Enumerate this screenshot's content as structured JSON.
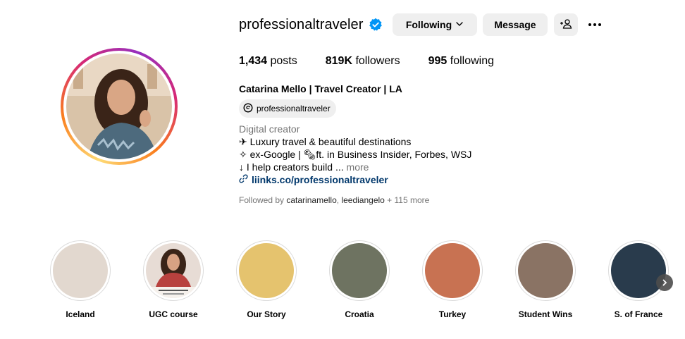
{
  "profile": {
    "username": "professionaltraveler",
    "verified_icon": "verified-badge-icon",
    "full_name": "Catarina Mello | Travel Creator | LA",
    "threads_handle": "professionaltraveler"
  },
  "actions": {
    "following_label": "Following",
    "message_label": "Message"
  },
  "stats": {
    "posts_count": "1,434",
    "posts_label": "posts",
    "followers_count": "819K",
    "followers_label": "followers",
    "following_count": "995",
    "following_label": "following"
  },
  "bio": {
    "category": "Digital creator",
    "line1": "✈ Luxury travel & beautiful destinations",
    "line2": "✧ ex-Google | 🗞ft. in Business Insider, Forbes, WSJ",
    "line3": "↓ I help creators build ...",
    "more_label": "more",
    "link": "liinks.co/professionaltraveler"
  },
  "followed_by": {
    "prefix": "Followed by",
    "user1": "catarinamello",
    "separator": ",",
    "user2": "leediangelo",
    "suffix": "+ 115 more"
  },
  "highlights": [
    {
      "label": "Iceland",
      "color": "#e2d8cf"
    },
    {
      "label": "UGC course",
      "color": "#c9b8ad"
    },
    {
      "label": "Our Story",
      "color": "#e5c36e"
    },
    {
      "label": "Croatia",
      "color": "#6e7361"
    },
    {
      "label": "Turkey",
      "color": "#c87252"
    },
    {
      "label": "Student Wins",
      "color": "#8a7364"
    },
    {
      "label": "S. of France",
      "color": "#293b4c"
    }
  ],
  "colors": {
    "link": "#00376b",
    "verified": "#0095f6",
    "button_bg": "#efefef",
    "muted": "#737373"
  }
}
